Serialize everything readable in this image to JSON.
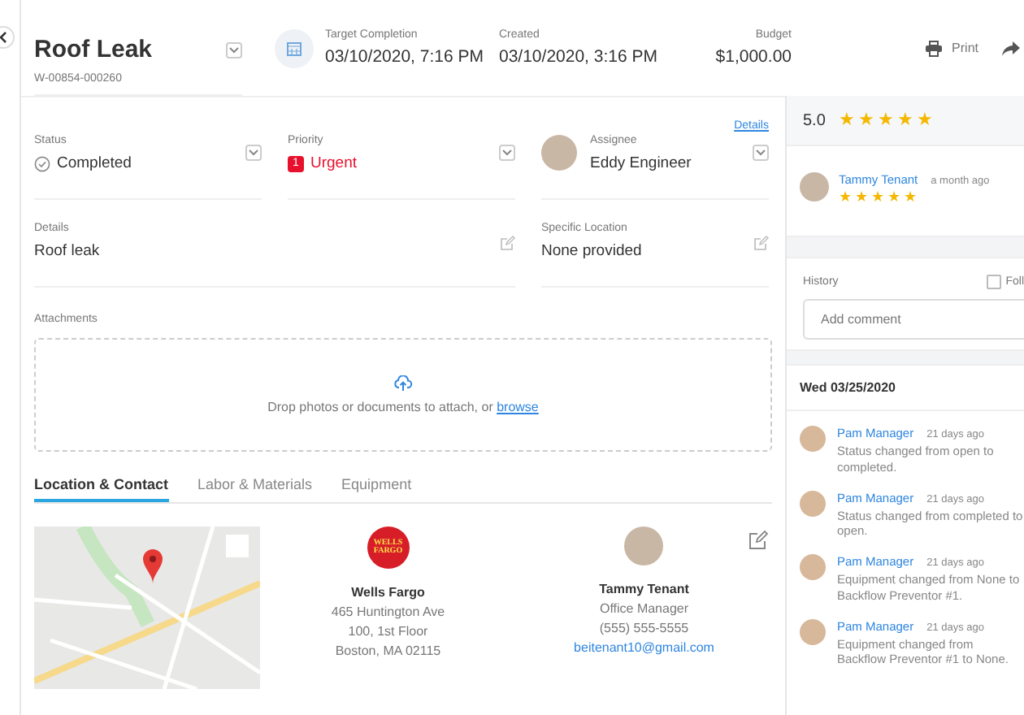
{
  "header": {
    "title": "Roof Leak",
    "id": "W-00854-000260",
    "meta": [
      {
        "label": "Target Completion",
        "value": "03/10/2020, 7:16 PM"
      },
      {
        "label": "Created",
        "value": "03/10/2020, 3:16 PM"
      },
      {
        "label": "Budget",
        "value": "$1,000.00"
      }
    ],
    "actions": [
      {
        "kind": "print",
        "label": "Print"
      },
      {
        "kind": "share"
      }
    ]
  },
  "fields_link": "Details",
  "fields": [
    {
      "kind": "status",
      "label": "Status",
      "value": "Completed"
    },
    {
      "kind": "priority",
      "label": "Priority",
      "value": "Urgent",
      "badge": "1"
    },
    {
      "kind": "person",
      "label": "Assignee",
      "value": "Eddy Engineer"
    },
    {
      "kind": "text",
      "label": "Details",
      "value": "Roof leak"
    },
    {
      "kind": "text",
      "label": "Specific Location",
      "value": "None provided"
    }
  ],
  "attachments": {
    "label": "Attachments",
    "prompt": "Drop photos or documents to attach, or ",
    "link": "browse"
  },
  "tabs": [
    {
      "label": "Location & Contact",
      "selected": true
    },
    {
      "label": "Labor & Materials",
      "selected": false
    },
    {
      "label": "Equipment",
      "selected": false
    }
  ],
  "location": {
    "logo_text": "WELLS FARGO",
    "name": "Wells Fargo",
    "lines": [
      "465 Huntington Ave",
      "100, 1st Floor",
      "Boston, MA 02115"
    ]
  },
  "contact": {
    "name": "Tammy Tenant",
    "lines": [
      "Office Manager",
      "(555) 555-5555"
    ],
    "email": "beitenant10@gmail.com"
  },
  "rating": {
    "score": "5.0",
    "stars": 5
  },
  "review": {
    "author": "Tammy Tenant",
    "time": "a month ago",
    "stars": 5
  },
  "history": {
    "label": "History",
    "follow_label": "Foll",
    "follow_checked": false,
    "comment_placeholder": "Add comment",
    "date": "Wed 03/25/2020",
    "entries": [
      {
        "author": "Pam Manager",
        "time": "21 days ago",
        "text": "Status changed from open to completed."
      },
      {
        "author": "Pam Manager",
        "time": "21 days ago",
        "text": "Status changed from completed to open."
      },
      {
        "author": "Pam Manager",
        "time": "21 days ago",
        "text": "Equipment changed from None to Backflow Preventor #1."
      },
      {
        "author": "Pam Manager",
        "time": "21 days ago",
        "text": "Equipment changed from Backflow Preventor #1 to None."
      }
    ]
  }
}
